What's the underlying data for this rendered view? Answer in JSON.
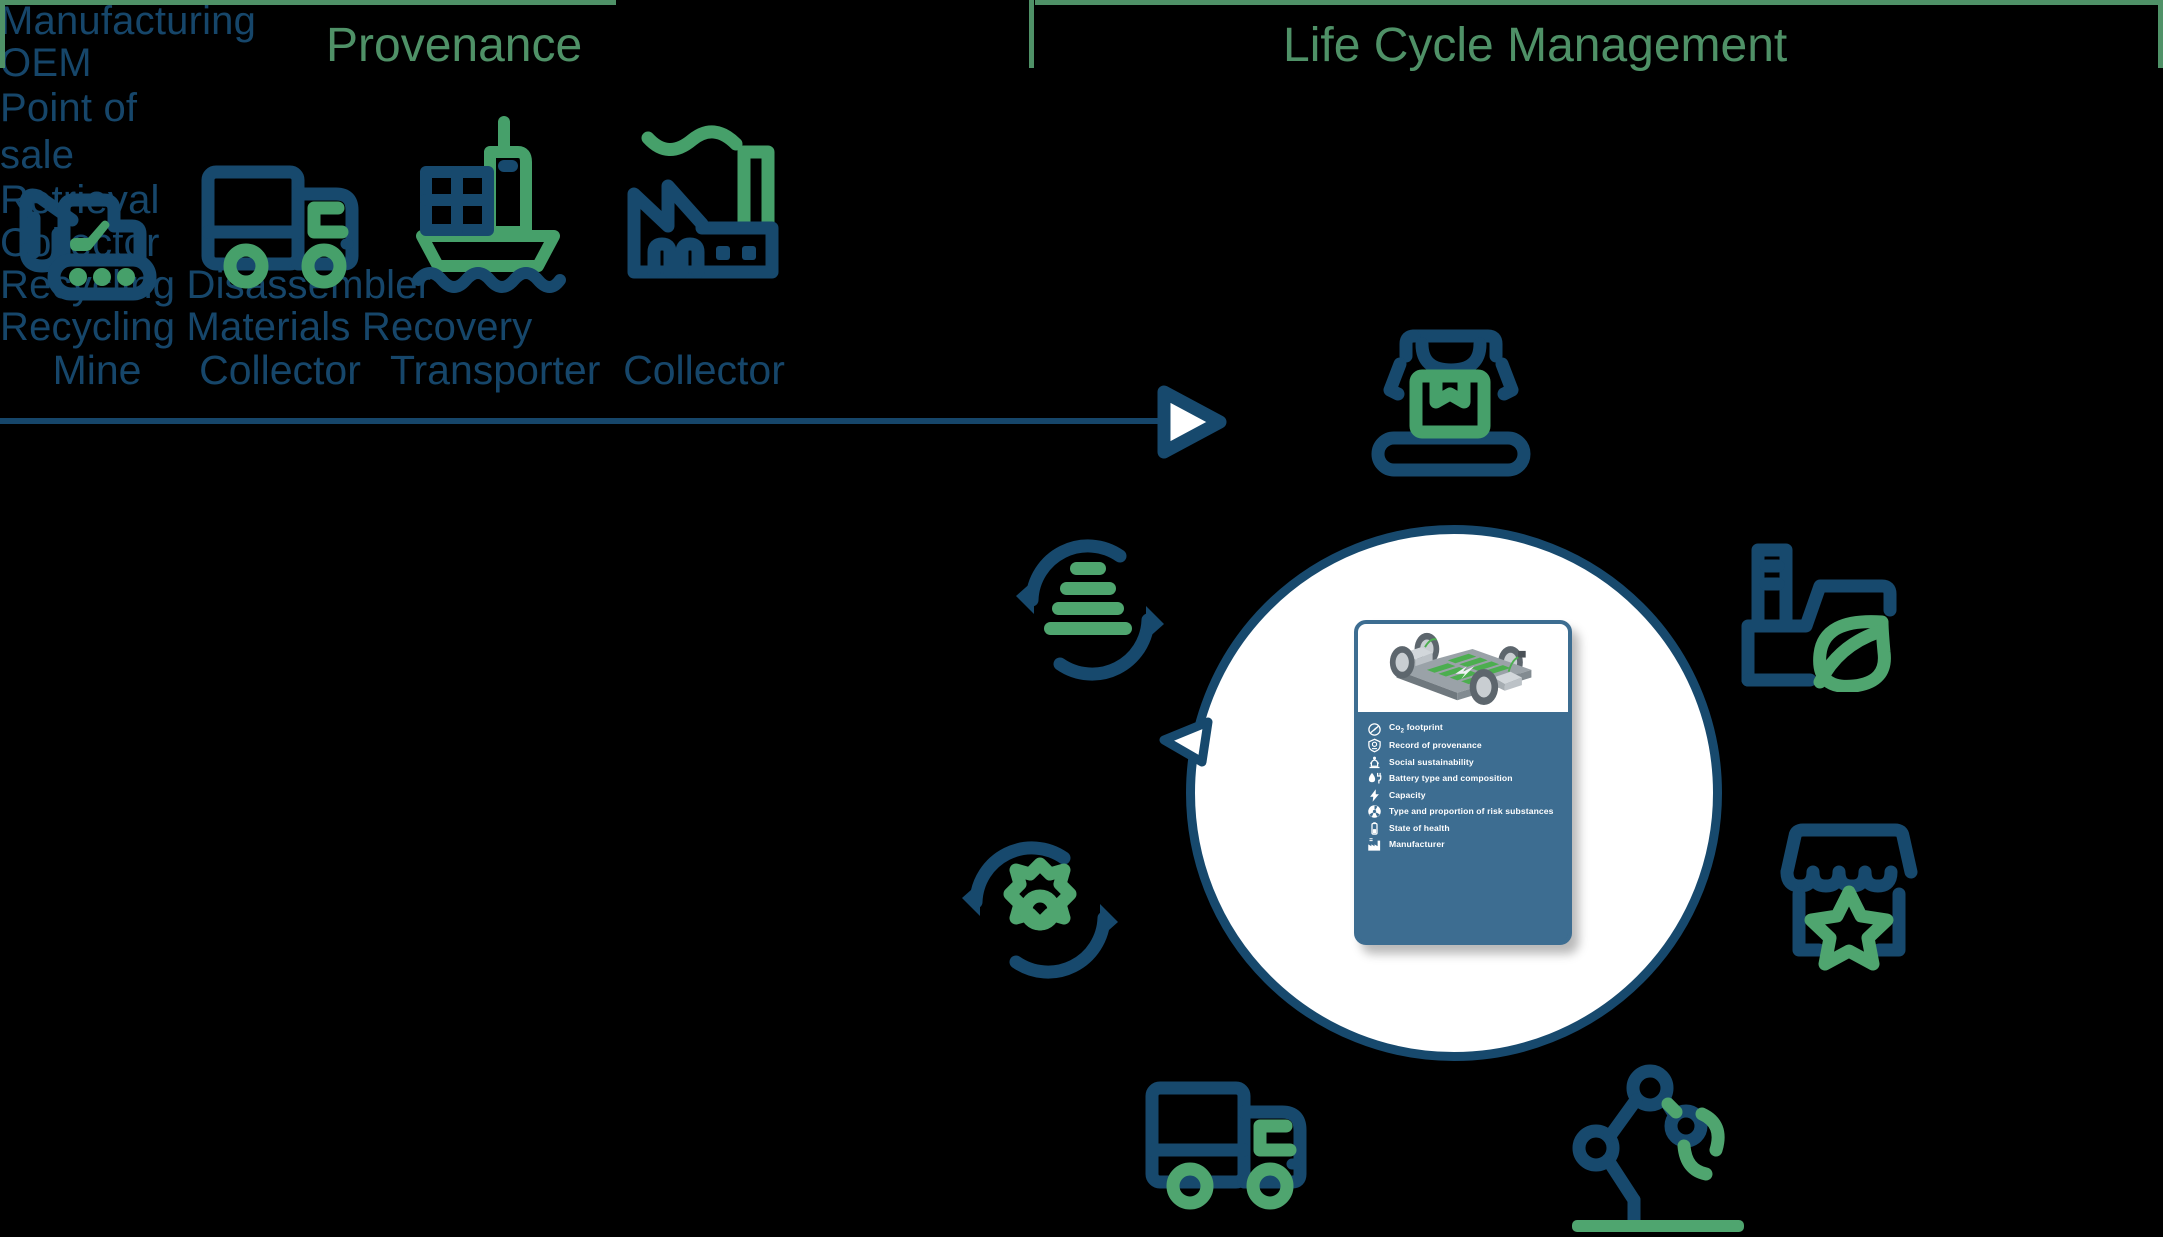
{
  "sections": {
    "provenance": {
      "title": "Provenance"
    },
    "lifecycle": {
      "title": "Life Cycle Management"
    }
  },
  "colors": {
    "navy": "#16466a",
    "deep_navy": "#17496d",
    "green": "#4f9167",
    "icon_green": "#46a06a",
    "card_blue": "#3d6d91",
    "white": "#ffffff",
    "background": "#000000"
  },
  "provenance_steps": [
    {
      "label": "Mine",
      "icon": "excavator-icon"
    },
    {
      "label": "Collector",
      "icon": "truck-icon"
    },
    {
      "label": "Transporter",
      "icon": "cargo-ship-icon"
    },
    {
      "label": "Collector",
      "icon": "factory-icon"
    }
  ],
  "flow": {
    "arrow_direction": "right",
    "cycle_arrow_direction": "counter-clockwise"
  },
  "lifecycle_stages": [
    {
      "label": "Manufacturing",
      "icon": "robot-gripper-conveyor-icon",
      "position": "top"
    },
    {
      "label": "OEM",
      "icon": "factory-leaf-icon",
      "position": "upper-right"
    },
    {
      "label": "Point of sale",
      "icon": "storefront-star-icon",
      "position": "lower-right"
    },
    {
      "label": "Retrieval",
      "icon": "robot-arm-icon",
      "position": "bottom-right"
    },
    {
      "label": "Collector",
      "icon": "truck-icon",
      "position": "bottom"
    },
    {
      "label": "Recycling Disassembler",
      "icon": "recycle-gear-icon",
      "position": "lower-left"
    },
    {
      "label": "Recycling Materials Recovery",
      "icon": "recycle-stack-icon",
      "position": "upper-left"
    }
  ],
  "battery_passport": {
    "image_alt": "ev-battery-chassis",
    "items": [
      {
        "label": "Co₂ footprint",
        "icon": "co2-footprint-icon"
      },
      {
        "label": "Record of provenance",
        "icon": "shield-provenance-icon"
      },
      {
        "label": "Social sustainability",
        "icon": "social-sustainability-icon"
      },
      {
        "label": "Battery type and composition",
        "icon": "battery-composition-icon"
      },
      {
        "label": "Capacity",
        "icon": "lightning-bolt-icon"
      },
      {
        "label": "Type and proportion of risk substances",
        "icon": "hazard-icon"
      },
      {
        "label": "State of health",
        "icon": "battery-health-icon"
      },
      {
        "label": "Manufacturer",
        "icon": "manufacturer-factory-icon"
      }
    ]
  }
}
